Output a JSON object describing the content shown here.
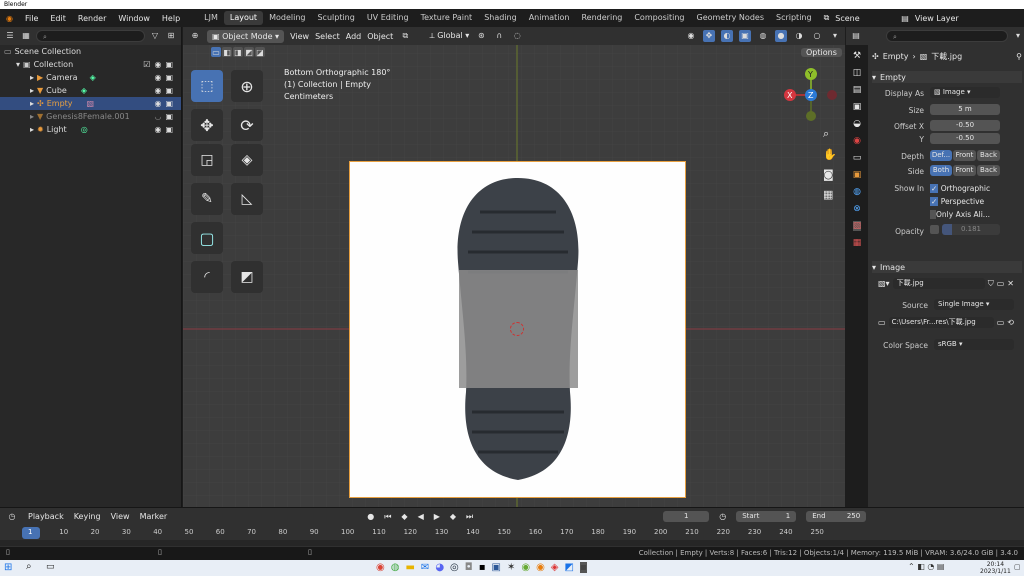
{
  "window": {
    "title": "Blender"
  },
  "menu": {
    "items": [
      "File",
      "Edit",
      "Render",
      "Window",
      "Help"
    ]
  },
  "workspaces": [
    "LJM",
    "Layout",
    "Modeling",
    "Sculpting",
    "UV Editing",
    "Texture Paint",
    "Shading",
    "Animation",
    "Rendering",
    "Compositing",
    "Geometry Nodes",
    "Scripting"
  ],
  "active_workspace": "Layout",
  "scene": {
    "name": "Scene",
    "view_layer": "View Layer"
  },
  "outliner": {
    "title": "Scene Collection",
    "items": [
      {
        "label": "Collection",
        "indent": 1
      },
      {
        "label": "Camera",
        "indent": 2
      },
      {
        "label": "Cube",
        "indent": 2
      },
      {
        "label": "Empty",
        "indent": 2,
        "selected": true
      },
      {
        "label": "Genesis8Female.001",
        "indent": 2,
        "dim": true
      },
      {
        "label": "Light",
        "indent": 2
      }
    ]
  },
  "viewport": {
    "mode": "Object Mode",
    "menus": [
      "View",
      "Select",
      "Add",
      "Object"
    ],
    "transform": "Global",
    "options": "Options",
    "overlay_text": [
      "Bottom Orthographic 180°",
      "(1) Collection | Empty",
      "Centimeters"
    ]
  },
  "properties": {
    "breadcrumb_obj": "Empty",
    "breadcrumb_img": "下載.jpg",
    "empty_panel": "Empty",
    "display_as_label": "Display As",
    "display_as": "Image",
    "size_label": "Size",
    "size": "5 m",
    "offset_x_label": "Offset X",
    "offset_x": "-0.50",
    "offset_y_label": "Y",
    "offset_y": "-0.50",
    "depth_label": "Depth",
    "depth_opts": [
      "Def...",
      "Front",
      "Back"
    ],
    "side_label": "Side",
    "side_opts": [
      "Both",
      "Front",
      "Back"
    ],
    "show_in_label": "Show In",
    "show_in": [
      "Orthographic",
      "Perspective",
      "Only Axis Ali..."
    ],
    "opacity_label": "Opacity",
    "opacity": "0.181",
    "opacity_fill": 0.181,
    "image_panel": "Image",
    "image_name": "下載.jpg",
    "source_label": "Source",
    "source": "Single Image",
    "path": "C:\\Users\\Fr...res\\下載.jpg",
    "colorspace_label": "Color Space",
    "colorspace": "sRGB"
  },
  "timeline": {
    "menus": [
      "Playback",
      "Keying",
      "View",
      "Marker"
    ],
    "frame": "1",
    "start_label": "Start",
    "start": "1",
    "end_label": "End",
    "end": "250",
    "ticks": [
      "1",
      "10",
      "20",
      "30",
      "40",
      "50",
      "60",
      "70",
      "80",
      "90",
      "100",
      "110",
      "120",
      "130",
      "140",
      "150",
      "160",
      "170",
      "180",
      "190",
      "200",
      "210",
      "220",
      "230",
      "240",
      "250"
    ]
  },
  "status": {
    "text": "Collection | Empty | Verts:8 | Faces:6 | Tris:12 | Objects:1/4 | Memory: 119.5 MiB | VRAM: 3.6/24.0 GiB | 3.4.0"
  },
  "taskbar": {
    "time": "20:14",
    "date": "2023/1/11"
  },
  "colors": {
    "accent": "#4772b3",
    "selection": "#334d80",
    "bg": "#3d3d3d"
  }
}
